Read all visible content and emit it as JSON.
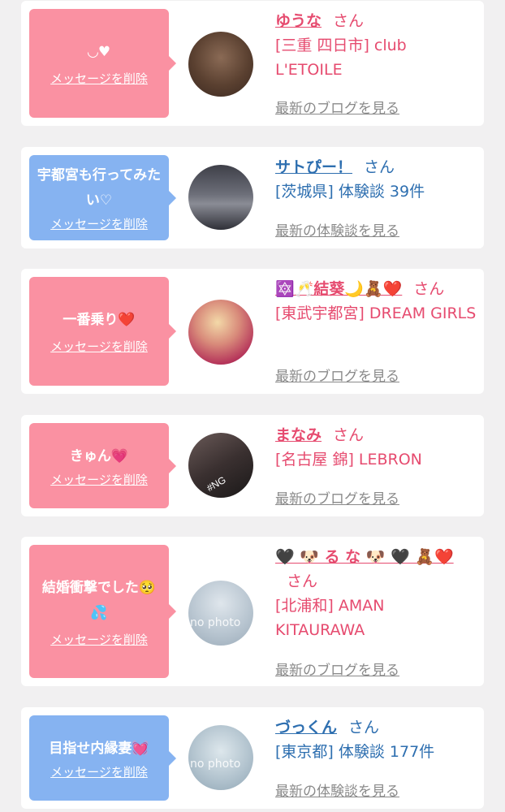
{
  "cards": [
    {
      "message": "◡♥",
      "delete_label": "メッセージを削除",
      "name": "ゆうな",
      "san": "さん",
      "shop": "[三重 四日市] club L'ETOILE",
      "link": "最新のブログを見る"
    },
    {
      "message": "宇都宮も行ってみたい♡",
      "delete_label": "メッセージを削除",
      "name": "サトぴー！",
      "san": "さん",
      "shop": "[茨城県] 体験談 39件",
      "link": "最新の体験談を見る"
    },
    {
      "message": "一番乗り❤️",
      "delete_label": "メッセージを削除",
      "name": "🔯🥂結葵🌙🧸❤️",
      "san": "さん",
      "shop": "[東武宇都宮] DREAM GIRLS",
      "link": "最新のブログを見る"
    },
    {
      "message": "きゅん💗",
      "delete_label": "メッセージを削除",
      "name": "まなみ",
      "san": "さん",
      "shop": "[名古屋 錦] LEBRON",
      "link": "最新のブログを見る",
      "avatar_tag": "#NG"
    },
    {
      "message": "結婚衝撃でした🥺💦",
      "delete_label": "メッセージを削除",
      "name": "🖤 🐶 る な 🐶 🖤 🧸❤️",
      "san": "さん",
      "shop": "[北浦和] AMAN KITAURAWA",
      "link": "最新のブログを見る",
      "avatar_text": "no photo"
    },
    {
      "message": "目指せ内縁妻💓",
      "delete_label": "メッセージを削除",
      "name": "づっくん",
      "san": "さん",
      "shop": "[東京都] 体験談 177件",
      "link": "最新の体験談を見る",
      "avatar_text": "no photo"
    }
  ],
  "colors": {
    "pink_bubble": "#fa91a2",
    "blue_bubble": "#86b3f1",
    "pink_text": "#e64b6f",
    "blue_text": "#2e6fb0"
  }
}
